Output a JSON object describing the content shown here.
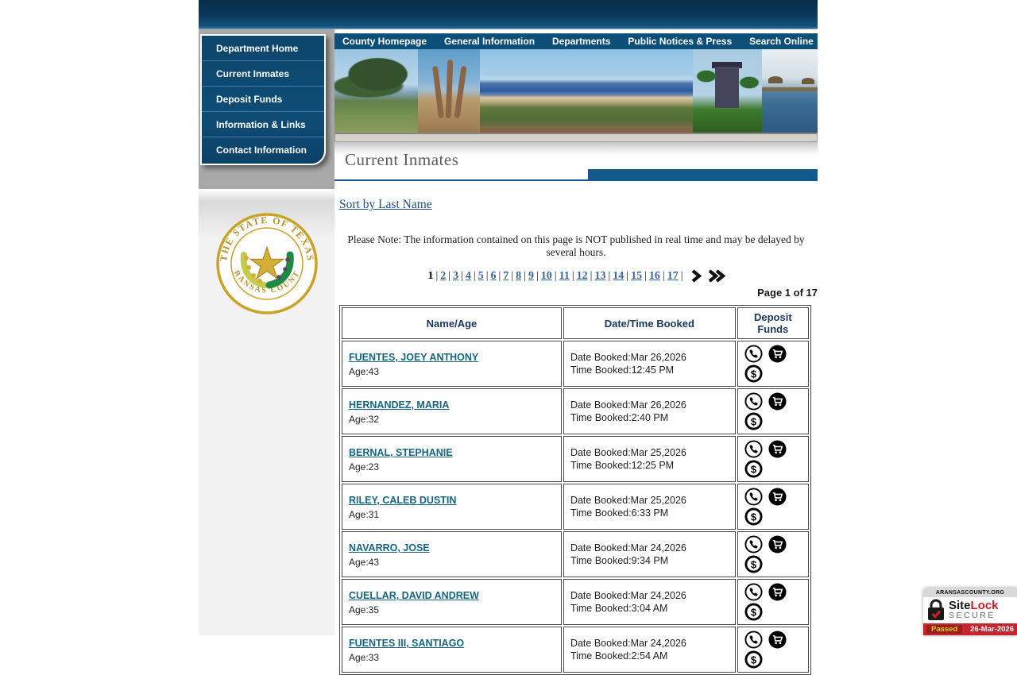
{
  "top_nav": {
    "items": [
      "County Homepage",
      "General Information",
      "Departments",
      "Public Notices & Press",
      "Search Online"
    ]
  },
  "sidebar": {
    "items": [
      {
        "label": "Department Home"
      },
      {
        "label": "Current Inmates"
      },
      {
        "label": "Deposit Funds"
      },
      {
        "label": "Information & Links"
      },
      {
        "label": "Contact Information"
      }
    ]
  },
  "seal": {
    "top_text": "THE STATE OF TEXAS",
    "bottom_text": "ARANSAS COUNTY"
  },
  "banner_photos": [
    "oak-tree",
    "sculpture",
    "bay-beach-panorama",
    "house-with-palms",
    "fishing-pier"
  ],
  "page": {
    "title": "Current Inmates",
    "sort_link": "Sort by Last Name",
    "note": "Please Note: The information contained on this page is NOT published in real time and may be delayed by several hours.",
    "page_label": "Page 1 of 17"
  },
  "pagination": {
    "current": "1",
    "pages": [
      "1",
      "2",
      "3",
      "4",
      "5",
      "6",
      "7",
      "8",
      "9",
      "10",
      "11",
      "12",
      "13",
      "14",
      "15",
      "16",
      "17"
    ],
    "separator": "|",
    "arrows": [
      "next-page-arrow",
      "last-page-arrow"
    ]
  },
  "table": {
    "headers": [
      "Name/Age",
      "Date/Time Booked",
      "Deposit Funds"
    ],
    "icon_names": [
      "phone-icon",
      "cart-icon",
      "dollar-icon"
    ],
    "rows": [
      {
        "name": "FUENTES, JOEY ANTHONY",
        "age": "Age:43",
        "date": "Date Booked:Mar 26,2026",
        "time": "Time Booked:12:45 PM"
      },
      {
        "name": "HERNANDEZ, MARIA",
        "age": "Age:32",
        "date": "Date Booked:Mar 26,2026",
        "time": "Time Booked:2:40 PM"
      },
      {
        "name": "BERNAL, STEPHANIE",
        "age": "Age:23",
        "date": "Date Booked:Mar 25,2026",
        "time": "Time Booked:12:25 PM"
      },
      {
        "name": "RILEY, CALEB DUSTIN",
        "age": "Age:31",
        "date": "Date Booked:Mar 25,2026",
        "time": "Time Booked:6:33 PM"
      },
      {
        "name": "NAVARRO, JOSE",
        "age": "Age:43",
        "date": "Date Booked:Mar 24,2026",
        "time": "Time Booked:9:34 PM"
      },
      {
        "name": "CUELLAR, DAVID ANDREW",
        "age": "Age:35",
        "date": "Date Booked:Mar 24,2026",
        "time": "Time Booked:3:04 AM"
      },
      {
        "name": "FUENTES III, SANTIAGO",
        "age": "Age:33",
        "date": "Date Booked:Mar 24,2026",
        "time": "Time Booked:2:54 AM"
      }
    ]
  },
  "badge": {
    "domain": "ARANSASCOUNTY.ORG",
    "brand_site": "Site",
    "brand_lock": "Lock",
    "secure_label": "SECURE",
    "status": "Passed",
    "date": "26-Mar-2026"
  },
  "colors": {
    "accent_blue": "#0e4f7a",
    "title_bar_blue": "#14598c",
    "link_blue": "#3465a4",
    "name_link_teal": "#17657f",
    "sitelock_red": "#c1272d",
    "passed_yellow": "#d6cf1e",
    "seal_gold": "#c9a227"
  }
}
